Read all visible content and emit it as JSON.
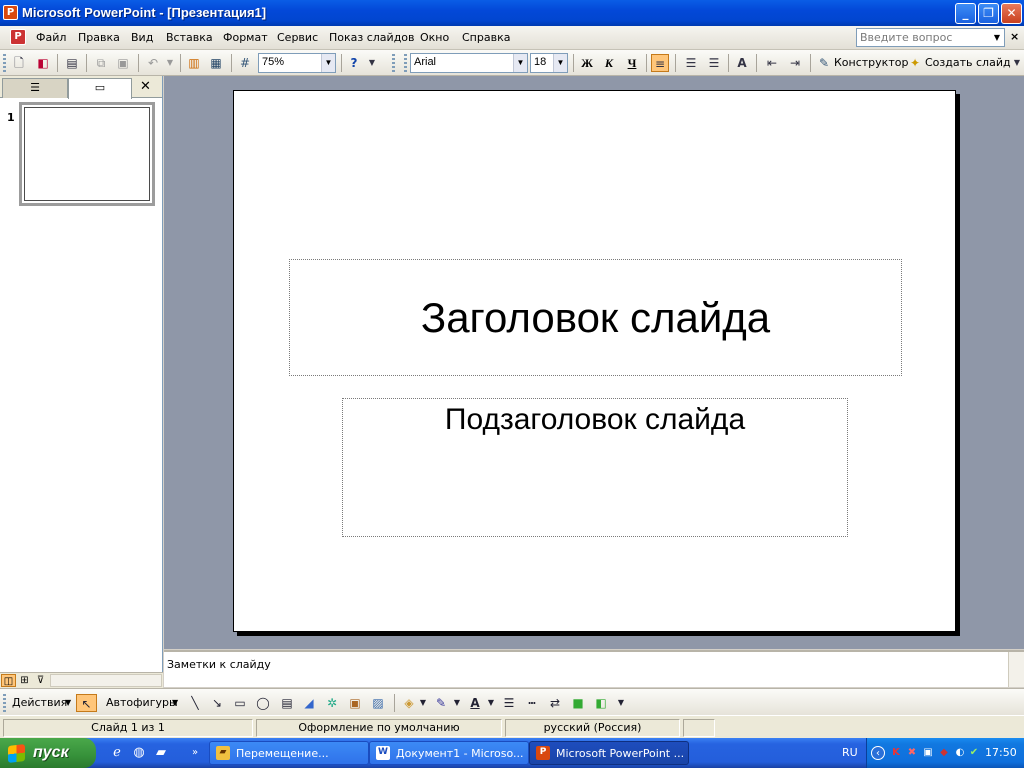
{
  "window": {
    "title": "Microsoft PowerPoint - [Презентация1]",
    "min": "_",
    "max": "❐",
    "close": "✕"
  },
  "menu": {
    "items": [
      "Файл",
      "Правка",
      "Вид",
      "Вставка",
      "Формат",
      "Сервис",
      "Показ слайдов",
      "Окно",
      "Справка"
    ],
    "help_placeholder": "Введите вопрос",
    "close": "×"
  },
  "toolbar": {
    "zoom": "75%",
    "font": "Arial",
    "size": "18",
    "bold": "Ж",
    "italic": "К",
    "underline": "Ч",
    "designer": "Конструктор",
    "new_slide": "Создать слайд"
  },
  "left_panel": {
    "slide_number": "1",
    "close": "✕"
  },
  "slide": {
    "title": "Заголовок слайда",
    "subtitle": "Подзаголовок слайда"
  },
  "notes": {
    "placeholder": "Заметки к слайду"
  },
  "draw_toolbar": {
    "actions": "Действия",
    "autoshapes": "Автофигуры"
  },
  "status": {
    "slide": "Слайд 1 из 1",
    "design": "Оформление по умолчанию",
    "language": "русский (Россия)"
  },
  "taskbar": {
    "start": "пуск",
    "tasks": [
      "Перемещение...",
      "Документ1 - Microso...",
      "Microsoft PowerPoint ..."
    ],
    "lang": "RU",
    "clock": "17:50"
  }
}
